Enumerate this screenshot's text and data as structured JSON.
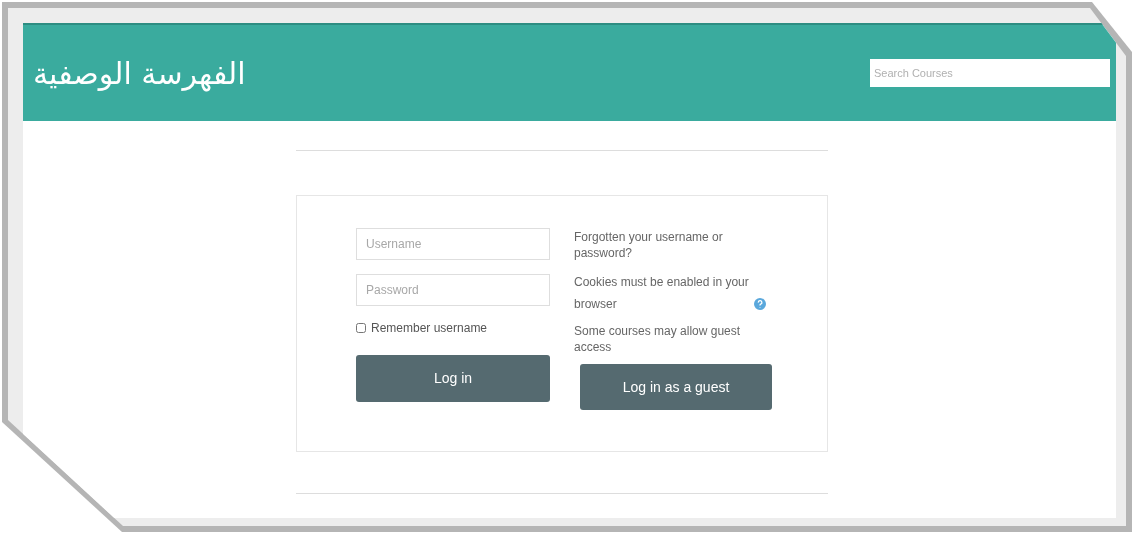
{
  "header": {
    "title": "الفهرسة الوصفية",
    "search": {
      "placeholder": "Search Courses"
    }
  },
  "login": {
    "username": {
      "placeholder": "Username"
    },
    "password": {
      "placeholder": "Password"
    },
    "remember": {
      "label": "Remember username",
      "checked": false
    },
    "login_button": "Log in"
  },
  "info": {
    "forgotten": "Forgotten your username or password?",
    "cookies": "Cookies must be enabled in your browser",
    "guest_note": "Some courses may allow guest access",
    "guest_button": "Log in as a guest"
  }
}
